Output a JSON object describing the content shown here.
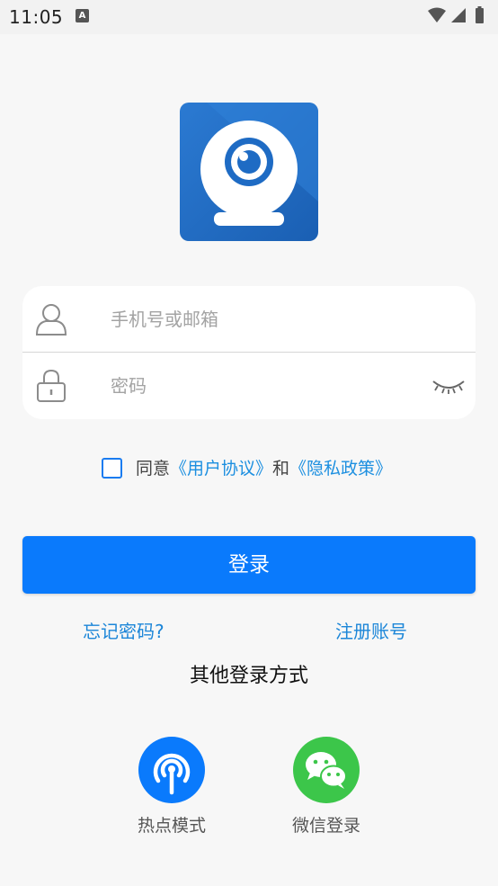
{
  "status_bar": {
    "time": "11:05",
    "notification_icon": "text-a-icon"
  },
  "logo": {
    "icon": "webcam-logo-icon",
    "background_color": "#1f6bbf"
  },
  "form": {
    "account_placeholder": "手机号或邮箱",
    "password_placeholder": "密码",
    "account_icon": "user-icon",
    "password_icon": "lock-icon",
    "eye_icon": "eye-closed-icon"
  },
  "agreement": {
    "prefix": "同意",
    "user_agreement": "《用户协议》",
    "conjunction": "和",
    "privacy_policy": "《隐私政策》"
  },
  "login_button": "登录",
  "forgot_password": "忘记密码?",
  "register": "注册账号",
  "other_login_title": "其他登录方式",
  "alt_logins": [
    {
      "label": "热点模式",
      "icon": "hotspot-icon",
      "color": "#0a7afc"
    },
    {
      "label": "微信登录",
      "icon": "wechat-icon",
      "color": "#3cc64a"
    }
  ],
  "colors": {
    "accent": "#0a7afc",
    "link": "#1c86d8",
    "background": "#f7f7f7"
  }
}
